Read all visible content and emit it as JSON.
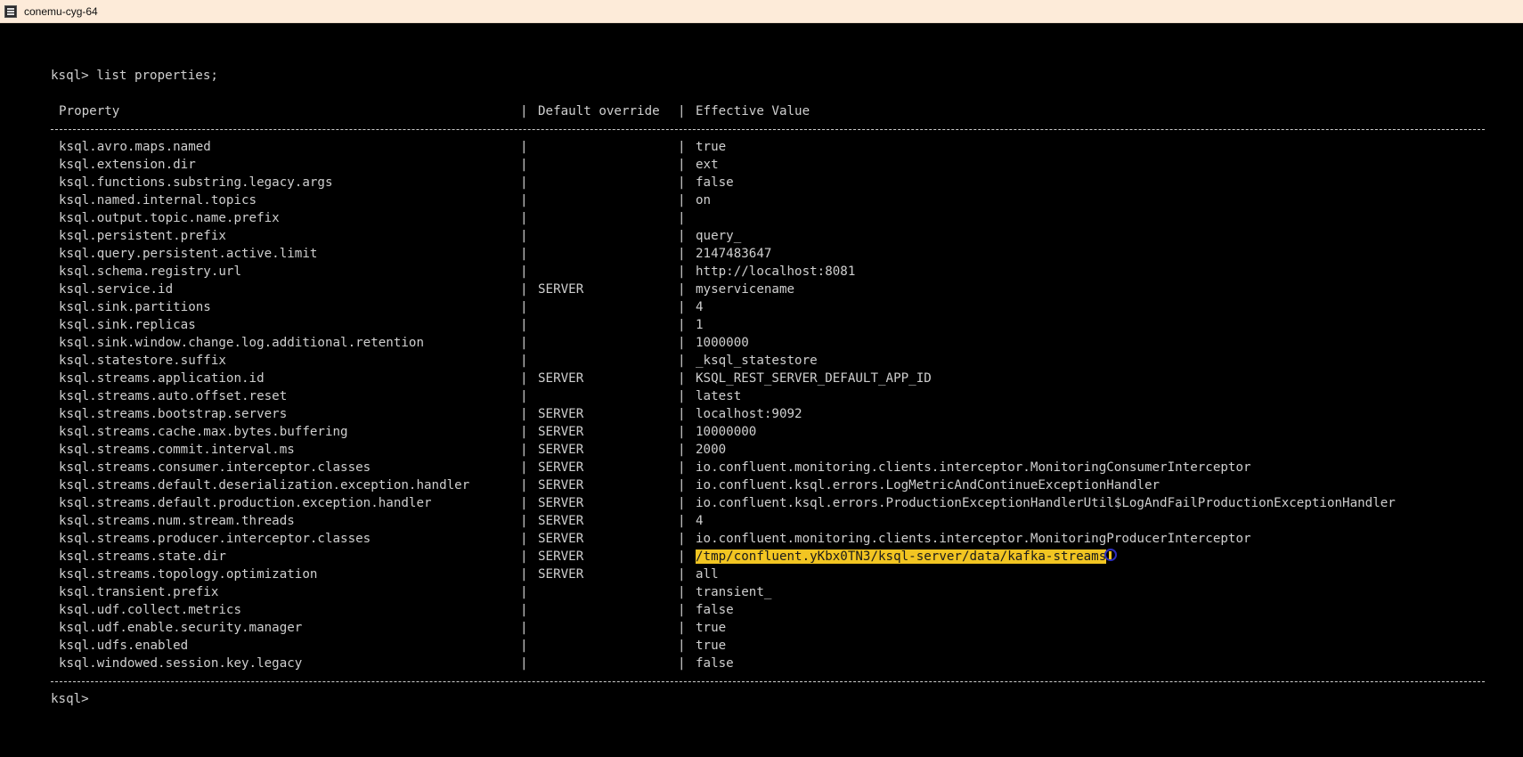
{
  "window": {
    "title": "conemu-cyg-64",
    "icon": "conemu-app-icon"
  },
  "terminal": {
    "command_line": "ksql> list properties;",
    "prompt_line": "ksql>",
    "headers": {
      "property": "Property",
      "default_override": "Default override",
      "effective_value": "Effective Value"
    },
    "separator": "|",
    "rows": [
      {
        "property": "ksql.avro.maps.named",
        "override": "",
        "value": "true"
      },
      {
        "property": "ksql.extension.dir",
        "override": "",
        "value": "ext"
      },
      {
        "property": "ksql.functions.substring.legacy.args",
        "override": "",
        "value": "false"
      },
      {
        "property": "ksql.named.internal.topics",
        "override": "",
        "value": "on"
      },
      {
        "property": "ksql.output.topic.name.prefix",
        "override": "",
        "value": ""
      },
      {
        "property": "ksql.persistent.prefix",
        "override": "",
        "value": "query_"
      },
      {
        "property": "ksql.query.persistent.active.limit",
        "override": "",
        "value": "2147483647"
      },
      {
        "property": "ksql.schema.registry.url",
        "override": "",
        "value": "http://localhost:8081"
      },
      {
        "property": "ksql.service.id",
        "override": "SERVER",
        "value": "myservicename"
      },
      {
        "property": "ksql.sink.partitions",
        "override": "",
        "value": "4"
      },
      {
        "property": "ksql.sink.replicas",
        "override": "",
        "value": "1"
      },
      {
        "property": "ksql.sink.window.change.log.additional.retention",
        "override": "",
        "value": "1000000"
      },
      {
        "property": "ksql.statestore.suffix",
        "override": "",
        "value": "_ksql_statestore"
      },
      {
        "property": "ksql.streams.application.id",
        "override": "SERVER",
        "value": "KSQL_REST_SERVER_DEFAULT_APP_ID"
      },
      {
        "property": "ksql.streams.auto.offset.reset",
        "override": "",
        "value": "latest"
      },
      {
        "property": "ksql.streams.bootstrap.servers",
        "override": "SERVER",
        "value": "localhost:9092"
      },
      {
        "property": "ksql.streams.cache.max.bytes.buffering",
        "override": "SERVER",
        "value": "10000000"
      },
      {
        "property": "ksql.streams.commit.interval.ms",
        "override": "SERVER",
        "value": "2000"
      },
      {
        "property": "ksql.streams.consumer.interceptor.classes",
        "override": "SERVER",
        "value": "io.confluent.monitoring.clients.interceptor.MonitoringConsumerInterceptor"
      },
      {
        "property": "ksql.streams.default.deserialization.exception.handler",
        "override": "SERVER",
        "value": "io.confluent.ksql.errors.LogMetricAndContinueExceptionHandler"
      },
      {
        "property": "ksql.streams.default.production.exception.handler",
        "override": "SERVER",
        "value": "io.confluent.ksql.errors.ProductionExceptionHandlerUtil$LogAndFailProductionExceptionHandler"
      },
      {
        "property": "ksql.streams.num.stream.threads",
        "override": "SERVER",
        "value": "4"
      },
      {
        "property": "ksql.streams.producer.interceptor.classes",
        "override": "SERVER",
        "value": "io.confluent.monitoring.clients.interceptor.MonitoringProducerInterceptor"
      },
      {
        "property": "ksql.streams.state.dir",
        "override": "SERVER",
        "value": "/tmp/confluent.yKbx0TN3/ksql-server/data/kafka-streams",
        "highlighted": true
      },
      {
        "property": "ksql.streams.topology.optimization",
        "override": "SERVER",
        "value": "all"
      },
      {
        "property": "ksql.transient.prefix",
        "override": "",
        "value": "transient_"
      },
      {
        "property": "ksql.udf.collect.metrics",
        "override": "",
        "value": "false"
      },
      {
        "property": "ksql.udf.enable.security.manager",
        "override": "",
        "value": "true"
      },
      {
        "property": "ksql.udfs.enabled",
        "override": "",
        "value": "true"
      },
      {
        "property": "ksql.windowed.session.key.legacy",
        "override": "",
        "value": "false"
      }
    ],
    "colors": {
      "background": "#000000",
      "text": "#cfcfcf",
      "highlight": "#f2c522",
      "titlebar": "#fdebd9",
      "cursor_ring": "#2d2fbf"
    }
  }
}
